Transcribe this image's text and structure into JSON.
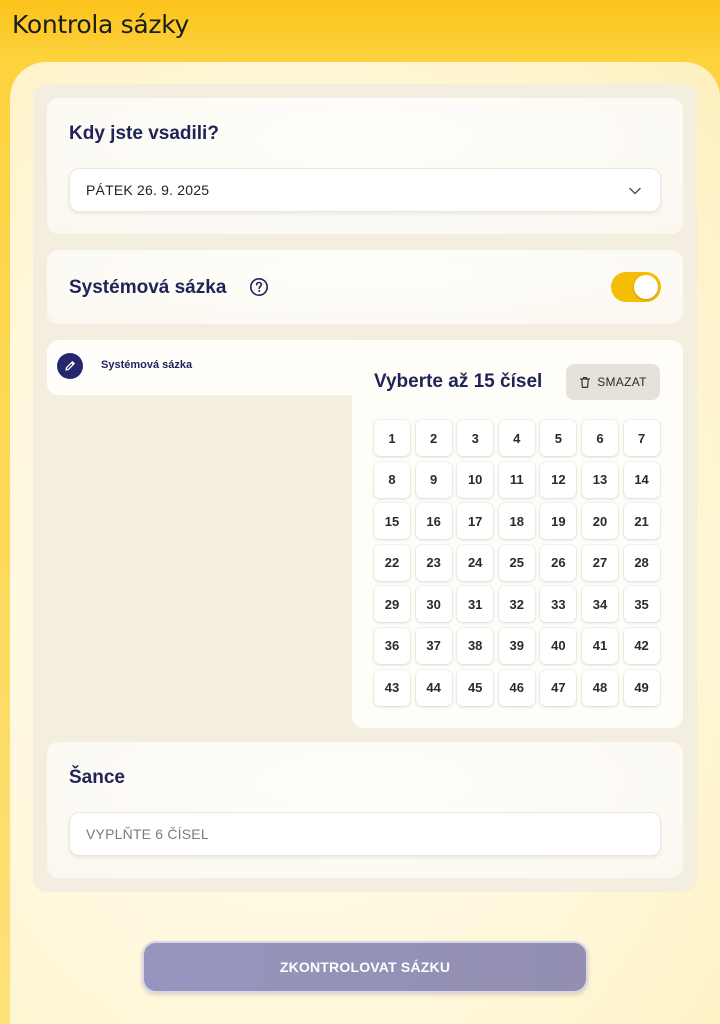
{
  "header": {
    "title": "Kontrola sázky"
  },
  "when": {
    "title": "Kdy jste vsadili?",
    "selected_date": "PÁTEK 26. 9. 2025",
    "chevron_icon": "chevron-down-icon"
  },
  "system": {
    "title": "Systémová sázka",
    "help_icon": "question-circle-icon",
    "toggle_on": true,
    "accent_color": "#f6bd07"
  },
  "ticket": {
    "tab_label": "Systémová sázka",
    "tab_icon": "pencil-icon",
    "title": "Vyberte až 15 čísel",
    "clear_label": "SMAZAT",
    "clear_icon": "trash-icon",
    "numbers": [
      "1",
      "2",
      "3",
      "4",
      "5",
      "6",
      "7",
      "8",
      "9",
      "10",
      "11",
      "12",
      "13",
      "14",
      "15",
      "16",
      "17",
      "18",
      "19",
      "20",
      "21",
      "22",
      "23",
      "24",
      "25",
      "26",
      "27",
      "28",
      "29",
      "30",
      "31",
      "32",
      "33",
      "34",
      "35",
      "36",
      "37",
      "38",
      "39",
      "40",
      "41",
      "42",
      "43",
      "44",
      "45",
      "46",
      "47",
      "48",
      "49"
    ]
  },
  "odds": {
    "title": "Šance",
    "placeholder": "VYPLŇTE 6 ČÍSEL"
  },
  "actions": {
    "check_label": "ZKONTROLOVAT SÁZKU"
  },
  "colors": {
    "header_yellow": "#fbc31a",
    "navy": "#1f2358",
    "button_disabled": "#9795bf"
  }
}
